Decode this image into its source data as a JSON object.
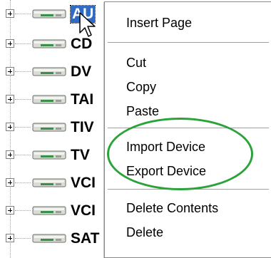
{
  "tree": {
    "items": [
      {
        "label": "AU",
        "selected": true
      },
      {
        "label": "CD",
        "selected": false
      },
      {
        "label": "DV",
        "selected": false
      },
      {
        "label": "TAI",
        "selected": false
      },
      {
        "label": "TIV",
        "selected": false
      },
      {
        "label": "TV",
        "selected": false
      },
      {
        "label": "VCI",
        "selected": false
      },
      {
        "label": "VCI",
        "selected": false
      },
      {
        "label": "SAT",
        "selected": false
      }
    ]
  },
  "context_menu": {
    "items": [
      {
        "label": "Insert Page"
      },
      {
        "label": "Cut"
      },
      {
        "label": "Copy"
      },
      {
        "label": "Paste"
      },
      {
        "label": "Import Device"
      },
      {
        "label": "Export Device"
      },
      {
        "label": "Delete Contents"
      },
      {
        "label": "Delete"
      }
    ]
  },
  "colors": {
    "selection": "#316ac5",
    "highlight_ellipse": "#2ca33a",
    "menu_border": "#8a8a8a"
  }
}
